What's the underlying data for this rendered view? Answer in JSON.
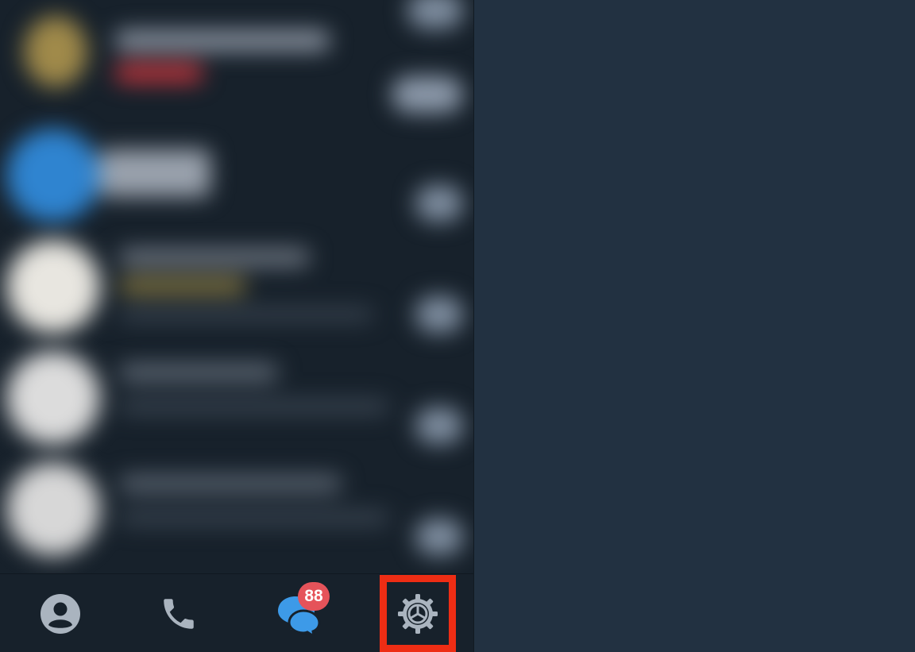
{
  "colors": {
    "sidebar_bg": "#17212b",
    "main_bg": "#223141",
    "icon_gray": "#aab4bf",
    "chats_blue": "#3d9ae8",
    "badge_red": "#e5535a",
    "highlight_red": "#ee2d14"
  },
  "bottom_bar": {
    "tabs": [
      {
        "id": "contacts",
        "icon": "person-circle-icon"
      },
      {
        "id": "calls",
        "icon": "phone-icon"
      },
      {
        "id": "chats",
        "icon": "chat-bubbles-icon",
        "badge": "88",
        "active": true
      },
      {
        "id": "settings",
        "icon": "gear-icon",
        "highlighted": true
      }
    ]
  }
}
